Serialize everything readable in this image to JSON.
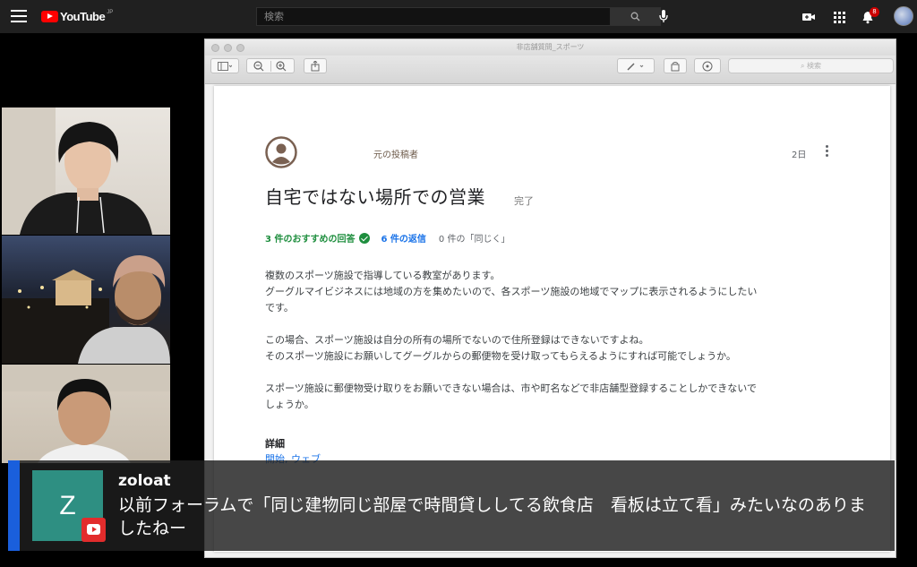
{
  "youtube": {
    "logo_text": "YouTube",
    "region": "JP",
    "search_placeholder": "検索",
    "notification_count": "8",
    "icons": [
      "menu-icon",
      "search-icon",
      "mic-icon",
      "create-video-icon",
      "apps-icon",
      "bell-icon",
      "account-avatar"
    ]
  },
  "preview_window": {
    "title": "非店舗質問_スポーツ",
    "search_placeholder": "検索"
  },
  "post": {
    "author_label": "元の投稿者",
    "age": "2日",
    "title": "自宅ではない場所での営業",
    "status": "完了",
    "recommended_answers": "3 件のおすすめの回答",
    "replies": "6 件の返信",
    "same_count": "0 件の「同じく」",
    "body": [
      "複数のスポーツ施設で指導している教室があります。",
      "グーグルマイビジネスには地域の方を集めたいので、各スポーツ施設の地域でマップに表示されるようにしたい",
      "です。",
      "この場合、スポーツ施設は自分の所有の場所でないので住所登録はできないですよね。",
      "そのスポーツ施設にお願いしてグーグルからの郵便物を受け取ってもらえるようにすれば可能でしょうか。",
      "スポーツ施設に郵便物受け取りをお願いできない場合は、市や町名などで非店舗型登録することしかできないで",
      "しょうか。"
    ],
    "details_heading": "詳細",
    "details_value": "開始, ウェブ"
  },
  "chat": {
    "avatar_letter": "Z",
    "username": "zoloat",
    "message_line1": "以前フォーラムで「同じ建物同じ部屋で時間貸ししてる飲食店　看板は立て看」みたいなのありま",
    "message_line2": "したねー",
    "accent_color": "#1a5fdc",
    "avatar_color": "#2e8f82"
  }
}
